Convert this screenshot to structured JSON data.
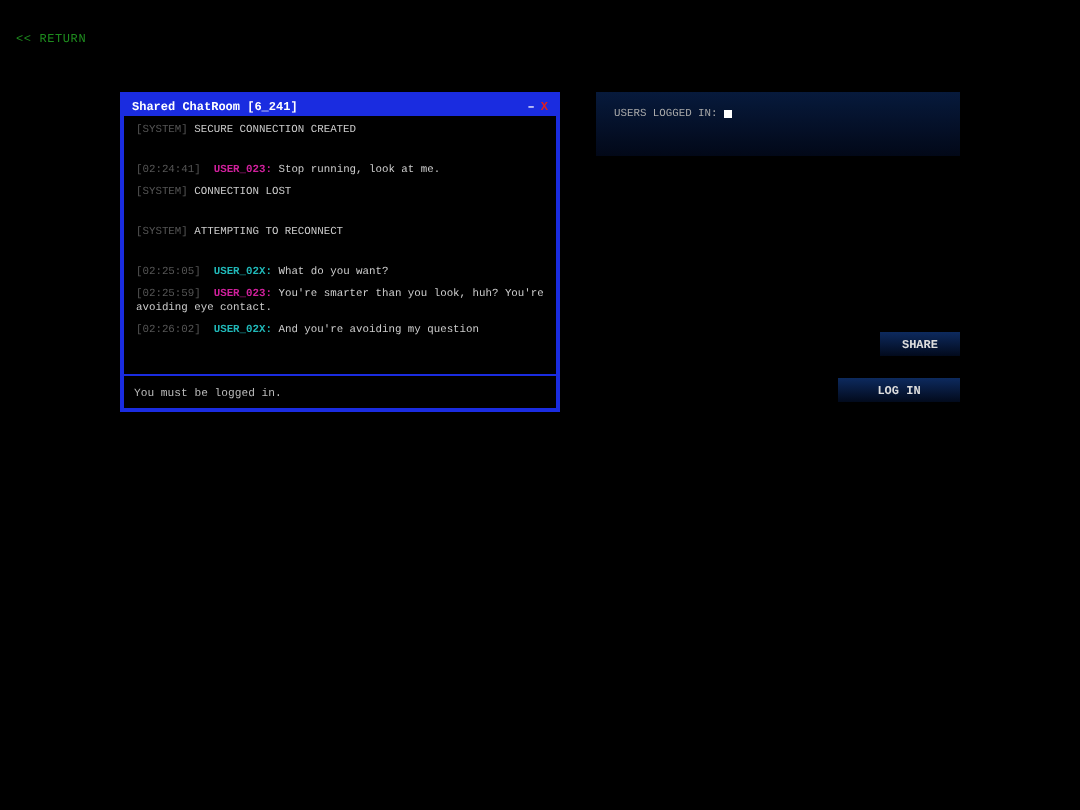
{
  "return_link": "<< RETURN",
  "chat_window": {
    "title": "Shared ChatRoom [6_241]",
    "minimize": "–",
    "close": "X",
    "messages": [
      {
        "kind": "system",
        "tag": "[SYSTEM]",
        "text": "SECURE CONNECTION CREATED"
      },
      {
        "kind": "user",
        "time": "[02:24:41]",
        "user": "USER_023:",
        "color": "#d0209c",
        "text": "Stop running, look at me."
      },
      {
        "kind": "system",
        "tag": "[SYSTEM]",
        "text": "CONNECTION LOST"
      },
      {
        "kind": "system",
        "tag": "[SYSTEM]",
        "text": "ATTEMPTING TO RECONNECT"
      },
      {
        "kind": "user",
        "time": "[02:25:05]",
        "user": "USER_02X:",
        "color": "#20b8b8",
        "text": "What do you want?"
      },
      {
        "kind": "user",
        "time": "[02:25:59]",
        "user": "USER_023:",
        "color": "#d0209c",
        "text": "You're smarter than you look, huh? You're avoiding eye contact."
      },
      {
        "kind": "user",
        "time": "[02:26:02]",
        "user": "USER_02X:",
        "color": "#20b8b8",
        "text": "And you're avoiding my question"
      }
    ],
    "input_placeholder": "You must be logged in."
  },
  "users_panel": {
    "label": "USERS LOGGED IN:"
  },
  "buttons": {
    "share": "SHARE",
    "login": "LOG IN"
  }
}
